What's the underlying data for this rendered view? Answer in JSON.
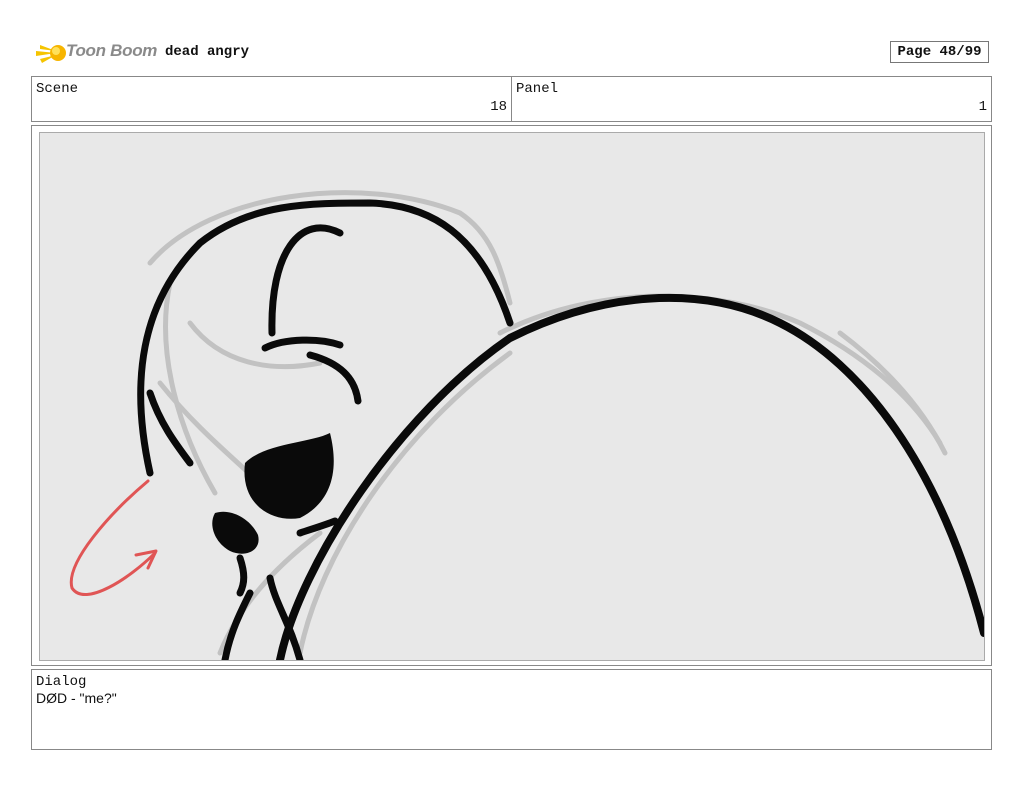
{
  "header": {
    "logo_text": "Toon Boom",
    "project_title": "dead angry",
    "page_label": "Page 48/99"
  },
  "scene": {
    "label": "Scene",
    "value": "18"
  },
  "panel": {
    "label": "Panel",
    "value": "1"
  },
  "dialog": {
    "label": "Dialog",
    "text": "DØD - \"me?\""
  },
  "colors": {
    "logo_accent": "#f5c400",
    "canvas_bg": "#e8e8e8",
    "ink": "#0a0a0a",
    "sketch": "#c2c2c2",
    "arrow": "#e05555"
  }
}
